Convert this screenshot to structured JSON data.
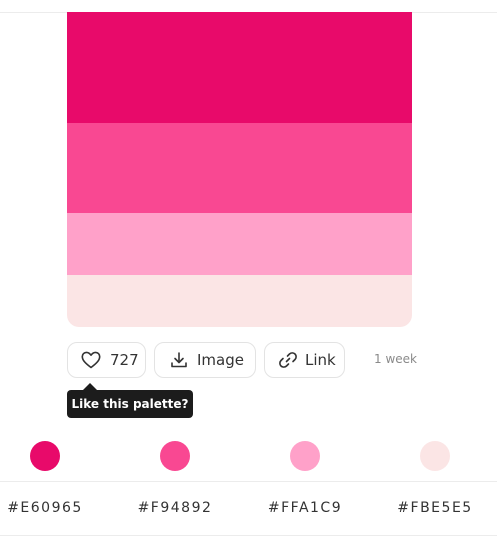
{
  "palette": {
    "colors": [
      {
        "hex": "#E60965",
        "fill": "#E80A6A"
      },
      {
        "hex": "#F94892",
        "fill": "#F94892"
      },
      {
        "hex": "#FFA1C9",
        "fill": "#FFA1C9"
      },
      {
        "hex": "#FBE5E5",
        "fill": "#FBE5E5"
      }
    ]
  },
  "actions": {
    "like_count": "727",
    "image_label": "Image",
    "link_label": "Link",
    "age": "1 week"
  },
  "tooltip": {
    "text": "Like this palette?"
  },
  "icons": {
    "like": "heart-icon",
    "image": "download-icon",
    "link": "link-icon"
  }
}
